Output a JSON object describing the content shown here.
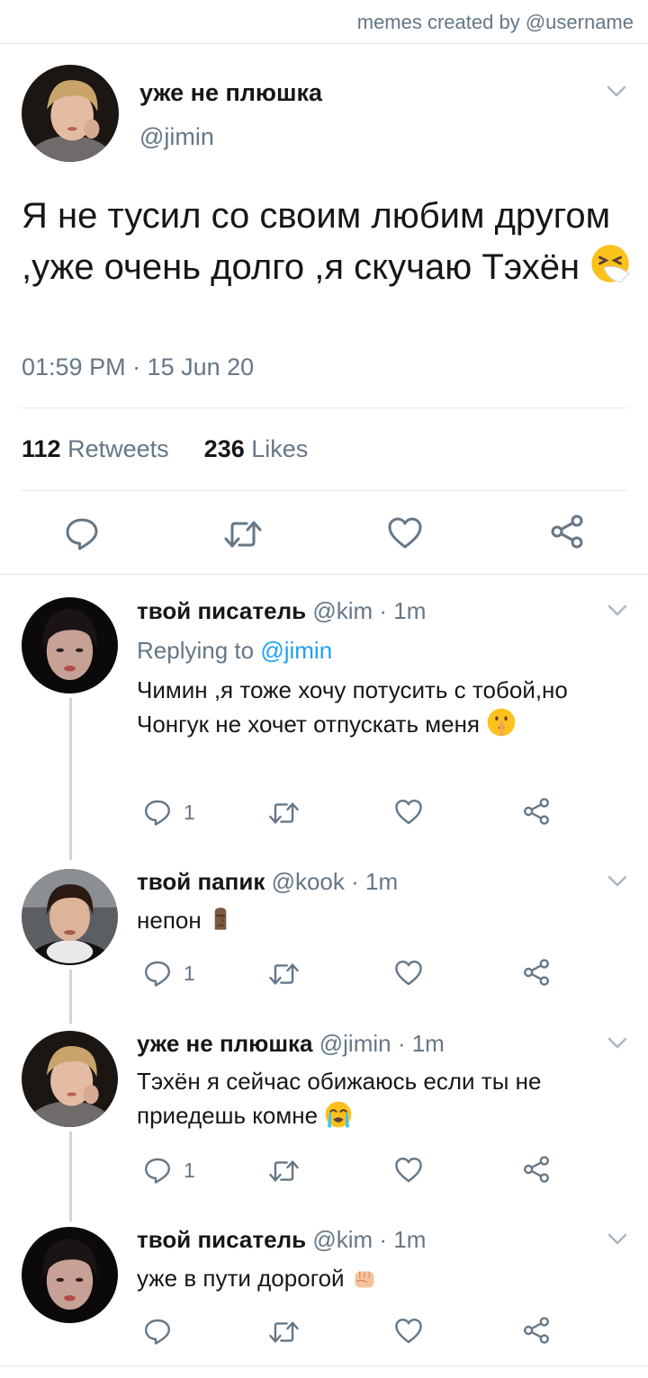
{
  "watermark": "memes created by @username",
  "main_tweet": {
    "display_name": "уже не плюшка",
    "handle": "@jimin",
    "text": "Я не тусил со своим любим другом ,уже очень долго ,я скучаю Тэхён",
    "emoji": "sneezing-face-emoji",
    "timestamp": "01:59 PM · 15 Jun 20",
    "retweets_count": "112",
    "retweets_label": "Retweets",
    "likes_count": "236",
    "likes_label": "Likes"
  },
  "replies": [
    {
      "display_name": "твой писатель",
      "handle": "@kim",
      "time": "· 1m",
      "replying_label": "Replying to",
      "replying_handle": "@jimin",
      "text": "Чимин ,я тоже хочу потусить с тобой,но Чонгук не хочет отпускать меня",
      "emoji": "shushing-face-emoji",
      "reply_count": "1"
    },
    {
      "display_name": "твой папик",
      "handle": "@kook",
      "time": "· 1m",
      "text": "непон",
      "emoji": "moai-emoji",
      "reply_count": "1"
    },
    {
      "display_name": "уже не плюшка",
      "handle": "@jimin",
      "time": "· 1m",
      "text": "Тэхён я сейчас обижаюсь если ты не приедешь комне",
      "emoji": "loudly-crying-face-emoji",
      "reply_count": "1"
    },
    {
      "display_name": "твой писатель",
      "handle": "@kim",
      "time": "· 1m",
      "text": "уже в пути дорогой",
      "emoji": "raised-fist-emoji"
    }
  ],
  "colors": {
    "text": "#14171a",
    "secondary": "#657786",
    "link": "#1da1f2",
    "divider": "#e1e8ed",
    "thread_line": "#ccd6dd"
  }
}
